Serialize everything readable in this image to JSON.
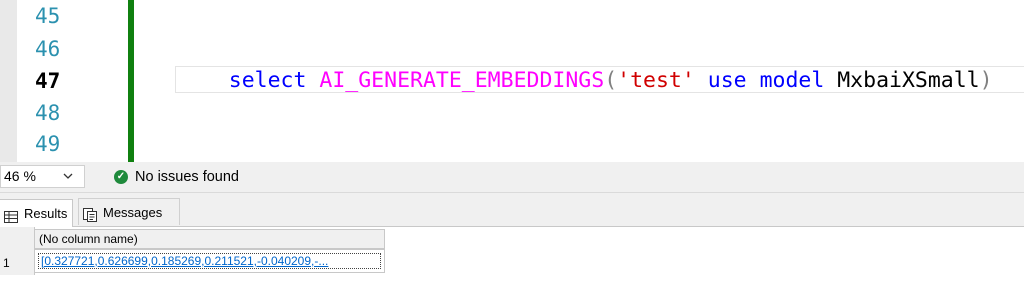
{
  "editor": {
    "line_numbers": [
      "45",
      "46",
      "47",
      "48",
      "49"
    ],
    "current_line": "47",
    "code_tokens": [
      {
        "text": "select",
        "kind": "kw"
      },
      {
        "text": " ",
        "kind": "plain"
      },
      {
        "text": "AI_GENERATE_EMBEDDINGS",
        "kind": "fn"
      },
      {
        "text": "(",
        "kind": "punc"
      },
      {
        "text": "'test'",
        "kind": "str"
      },
      {
        "text": " ",
        "kind": "plain"
      },
      {
        "text": "use",
        "kind": "kw"
      },
      {
        "text": " ",
        "kind": "plain"
      },
      {
        "text": "model",
        "kind": "kw"
      },
      {
        "text": " MxbaiXSmall",
        "kind": "plain"
      },
      {
        "text": ")",
        "kind": "punc"
      }
    ],
    "colors": {
      "keyword": "#0000ff",
      "function": "#ff00ff",
      "string": "#d00000",
      "change_bar": "#108010"
    }
  },
  "statusbar": {
    "zoom_value": "46 %",
    "issues_text": "No issues found",
    "issues_icon": "check-circle-icon"
  },
  "results": {
    "tabs": [
      {
        "label": "Results",
        "icon": "grid-icon",
        "active": true
      },
      {
        "label": "Messages",
        "icon": "messages-icon",
        "active": false
      }
    ],
    "grid": {
      "column_header": "(No column name)",
      "rows": [
        {
          "row_number": "1",
          "value": "[0.327721,0.626699,0.185269,0.211521,-0.040209,-..."
        }
      ]
    }
  }
}
